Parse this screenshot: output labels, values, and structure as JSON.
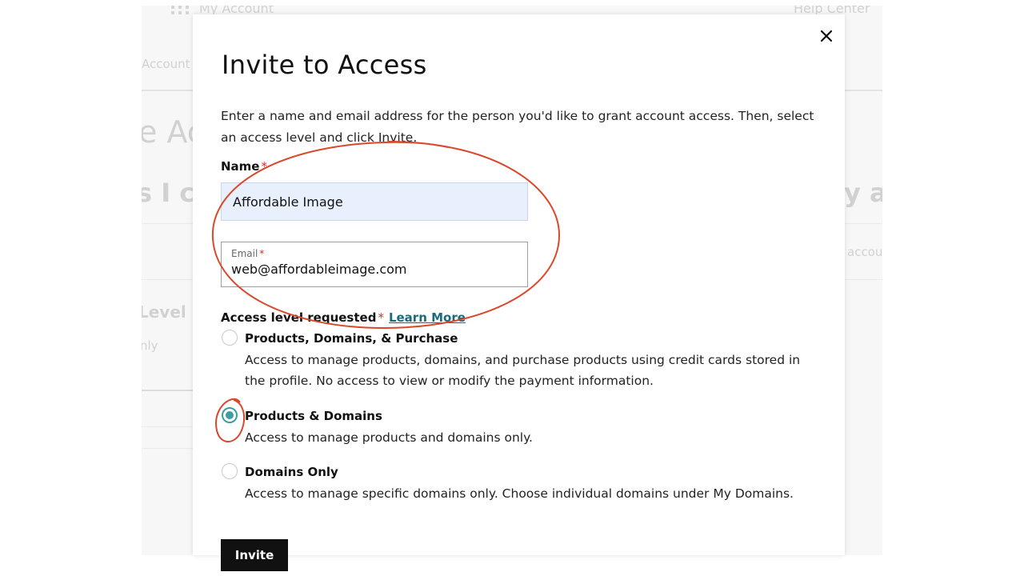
{
  "background": {
    "topbar_title": "My Account",
    "help_link": "Help Center",
    "tab_account": "Account",
    "heading_fragment": "e Ac",
    "subheading_fragment": "s I ca",
    "right_heading_fragment": "y a",
    "right_text_fragment": "accou",
    "level_fragment": "Level",
    "only_fragment": "nly"
  },
  "modal": {
    "title": "Invite to Access",
    "description": "Enter a name and email address for the person you'd like to grant account access. Then, select an access level and click Invite.",
    "name_label": "Name",
    "name_value": "Affordable Image",
    "email_label": "Email",
    "email_value": "web@affordableimage.com",
    "required_mark": "*",
    "access_label": "Access level requested",
    "learn_more": "Learn More",
    "options": [
      {
        "title": "Products, Domains, & Purchase",
        "description": "Access to manage products, domains, and purchase products using credit cards stored in the profile. No access to view or modify the payment information.",
        "selected": false
      },
      {
        "title": "Products & Domains",
        "description": "Access to manage products and domains only.",
        "selected": true
      },
      {
        "title": "Domains Only",
        "description": "Access to manage specific domains only. Choose individual domains under My Domains.",
        "selected": false
      }
    ],
    "invite_button": "Invite"
  },
  "icons": {
    "close": "close-icon",
    "app_grid": "grid-icon"
  },
  "colors": {
    "accent": "#3c9ea3",
    "link": "#1b6b7b",
    "required": "#d32f2f",
    "annotation": "#d9482b",
    "autofill_background": "#e8f0fe"
  }
}
